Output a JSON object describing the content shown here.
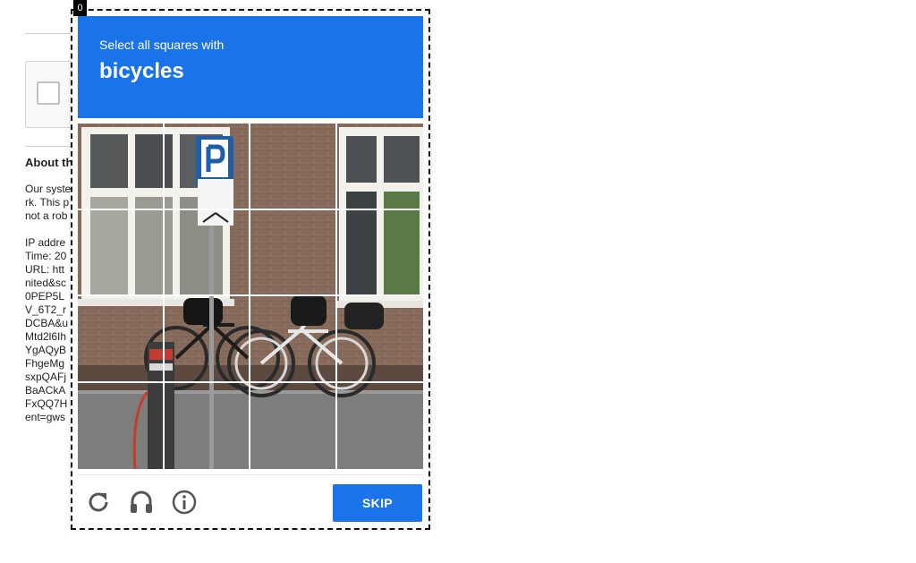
{
  "challenge": {
    "badge": "0",
    "instruction": "Select all squares with",
    "keyword": "bicycles",
    "grid_rows": 4,
    "grid_cols": 4,
    "skip_label": "SKIP"
  },
  "icons": {
    "reload": "reload-icon",
    "audio": "headphones-icon",
    "info": "info-icon"
  },
  "background_page": {
    "about_title": "About th",
    "lines": [
      "Our syste",
      "rk. This p",
      "not a rob",
      "",
      "IP addre",
      "Time: 20",
      "URL: htt",
      "nited&sc",
      "0PEP5L",
      "V_6T2_r",
      "DCBA&u",
      "Mtd2l6Ih",
      "YgAQyB",
      "FhgeMg",
      "sxpQAFj",
      "BaACkA",
      "FxQQ7H",
      "ent=gws"
    ]
  },
  "colors": {
    "accent": "#1a73e8",
    "frame_border": "#111111",
    "header_text": "#ffffff"
  }
}
